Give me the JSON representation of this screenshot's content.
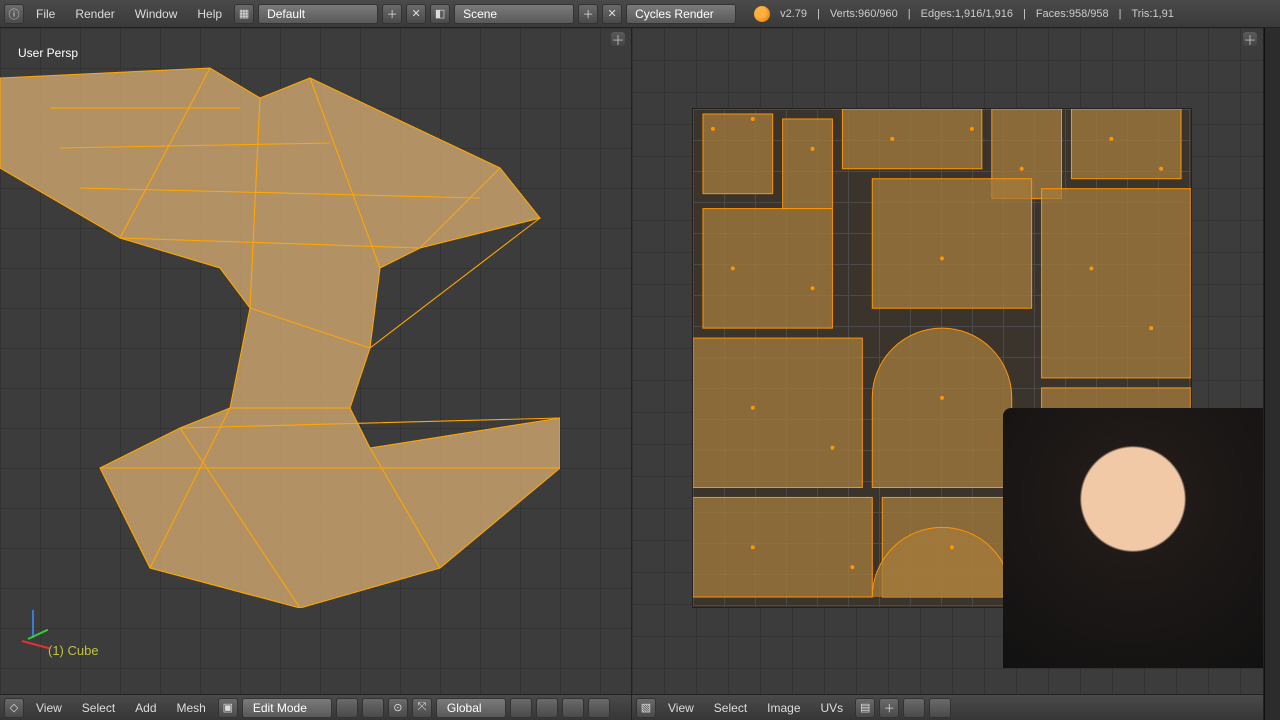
{
  "topbar": {
    "menus": [
      "File",
      "Render",
      "Window",
      "Help"
    ],
    "layout_label": "Default",
    "scene_label": "Scene",
    "engine_label": "Cycles Render",
    "version_label": "v2.79"
  },
  "stats": {
    "verts": "Verts:960/960",
    "edges": "Edges:1,916/1,916",
    "faces": "Faces:958/958",
    "tris": "Tris:1,91"
  },
  "viewport3d": {
    "header": "User Persp",
    "object_label": "(1) Cube",
    "footer_menus": [
      "View",
      "Select",
      "Add",
      "Mesh"
    ],
    "mode_label": "Edit Mode",
    "orientation_label": "Global"
  },
  "uv": {
    "footer_menus": [
      "View",
      "Select",
      "Image",
      "UVs"
    ]
  }
}
